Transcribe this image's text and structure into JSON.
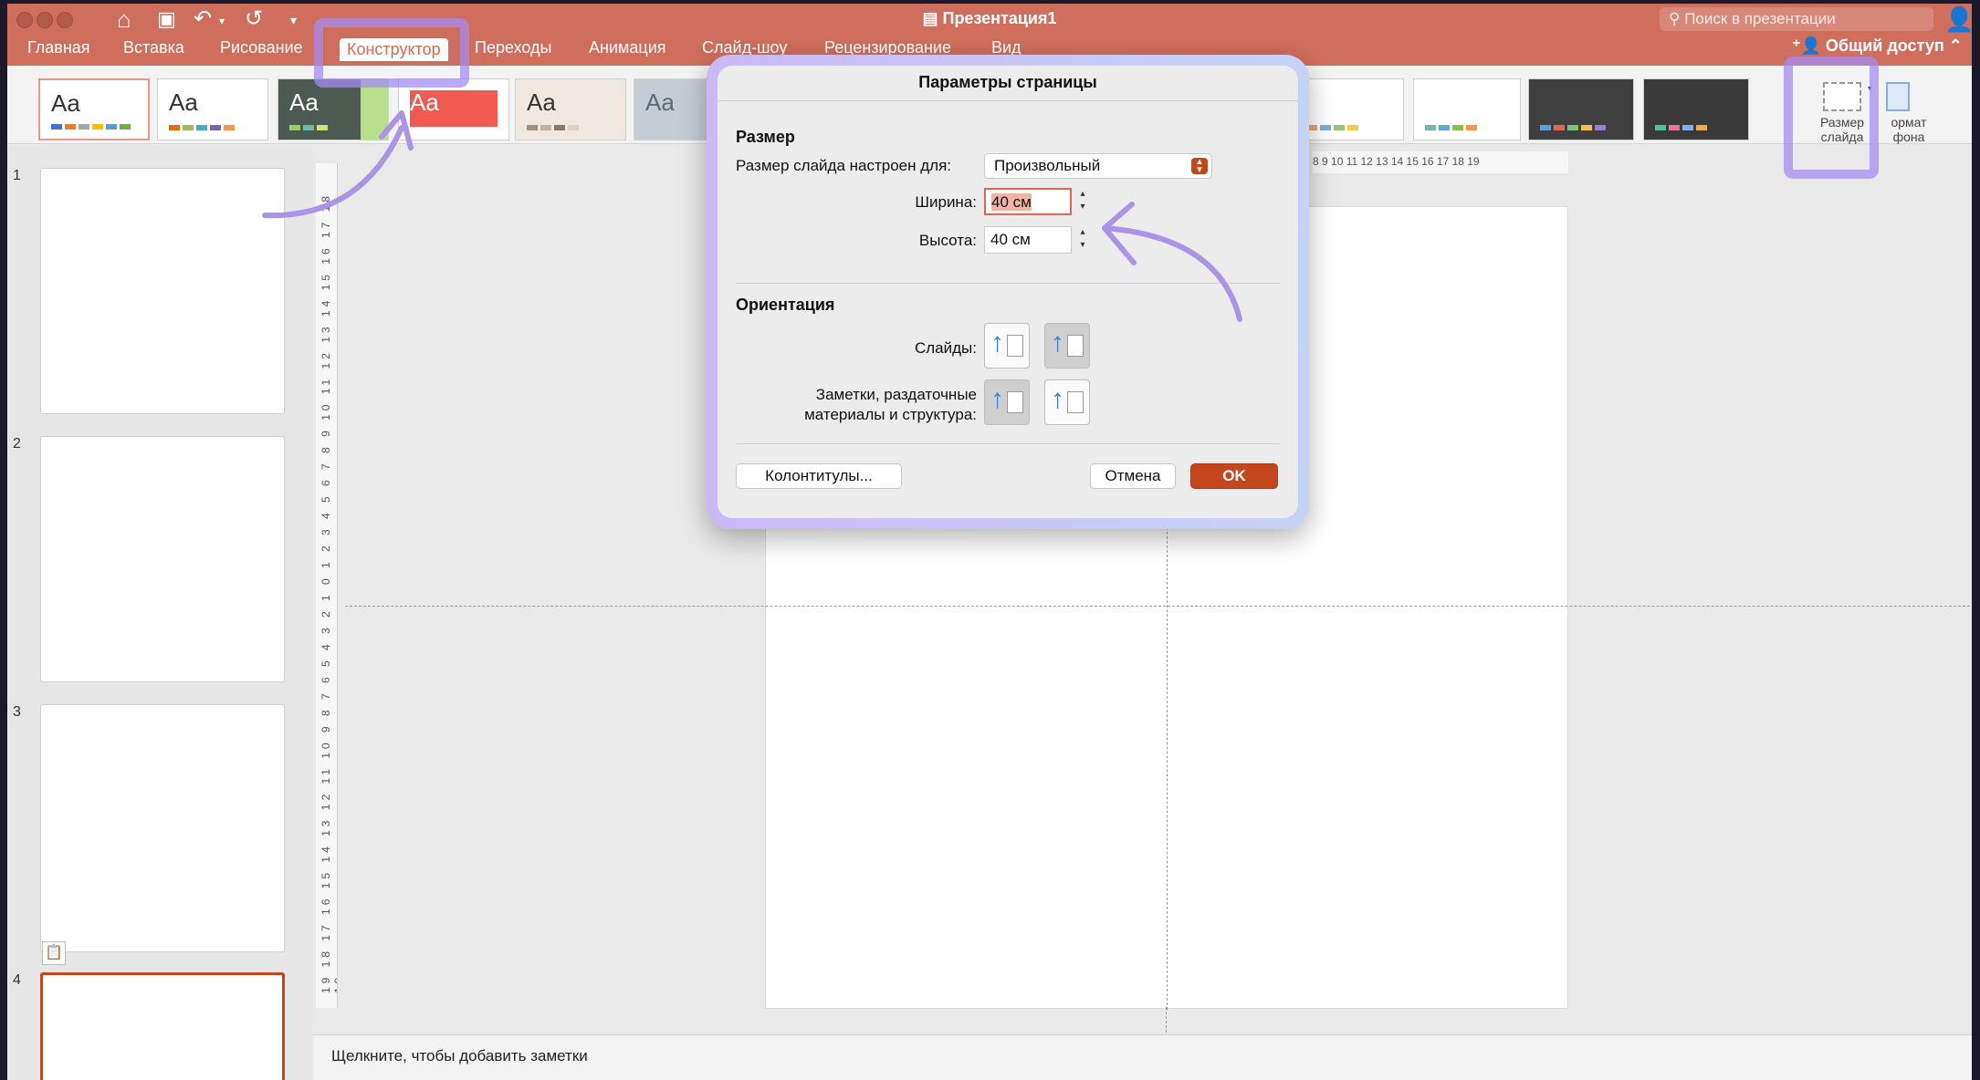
{
  "window": {
    "title": "Презентация1",
    "search_placeholder": "Поиск в презентации",
    "share_label": "Общий доступ"
  },
  "tabs": [
    {
      "label": "Главная"
    },
    {
      "label": "Вставка"
    },
    {
      "label": "Рисование"
    },
    {
      "label": "Конструктор",
      "active": true
    },
    {
      "label": "Переходы"
    },
    {
      "label": "Анимация"
    },
    {
      "label": "Слайд-шоу"
    },
    {
      "label": "Рецензирование"
    },
    {
      "label": "Вид"
    }
  ],
  "ribbon": {
    "theme_sample": "Aa",
    "slide_size_line1": "Размер",
    "slide_size_line2": "слайда",
    "format_bg_line1": "ормат",
    "format_bg_line2": "фона"
  },
  "thumbnails": [
    {
      "number": "1"
    },
    {
      "number": "2"
    },
    {
      "number": "3"
    },
    {
      "number": "4"
    }
  ],
  "ruler": {
    "h_ticks": "8 9 10 11 12 13 14 15 16 17 18 19",
    "v_ticks": "19 18 17 16 15 14 13 12 11 10 9 8 7 6 5 4 3 2 1 0 1 2 3 4 5 6 7 8 9 10 11 12 13 14 15 16 17 18 19"
  },
  "notes_placeholder": "Щелкните, чтобы добавить заметки",
  "dialog": {
    "title": "Параметры страницы",
    "size_section": "Размер",
    "slide_size_label": "Размер слайда настроен для:",
    "slide_size_value": "Произвольный",
    "width_label": "Ширина:",
    "width_value": "40 см",
    "height_label": "Высота:",
    "height_value": "40 см",
    "orientation_section": "Ориентация",
    "slides_label": "Слайды:",
    "notes_label_line1": "Заметки, раздаточные",
    "notes_label_line2": "материалы и структура:",
    "headers_button": "Колонтитулы...",
    "cancel_button": "Отмена",
    "ok_button": "OK"
  },
  "colors": {
    "title_bar": "#cf6e5c",
    "highlight": "#a68cf2",
    "ok_button": "#c4461d",
    "active_tab_text": "#d86b56"
  }
}
